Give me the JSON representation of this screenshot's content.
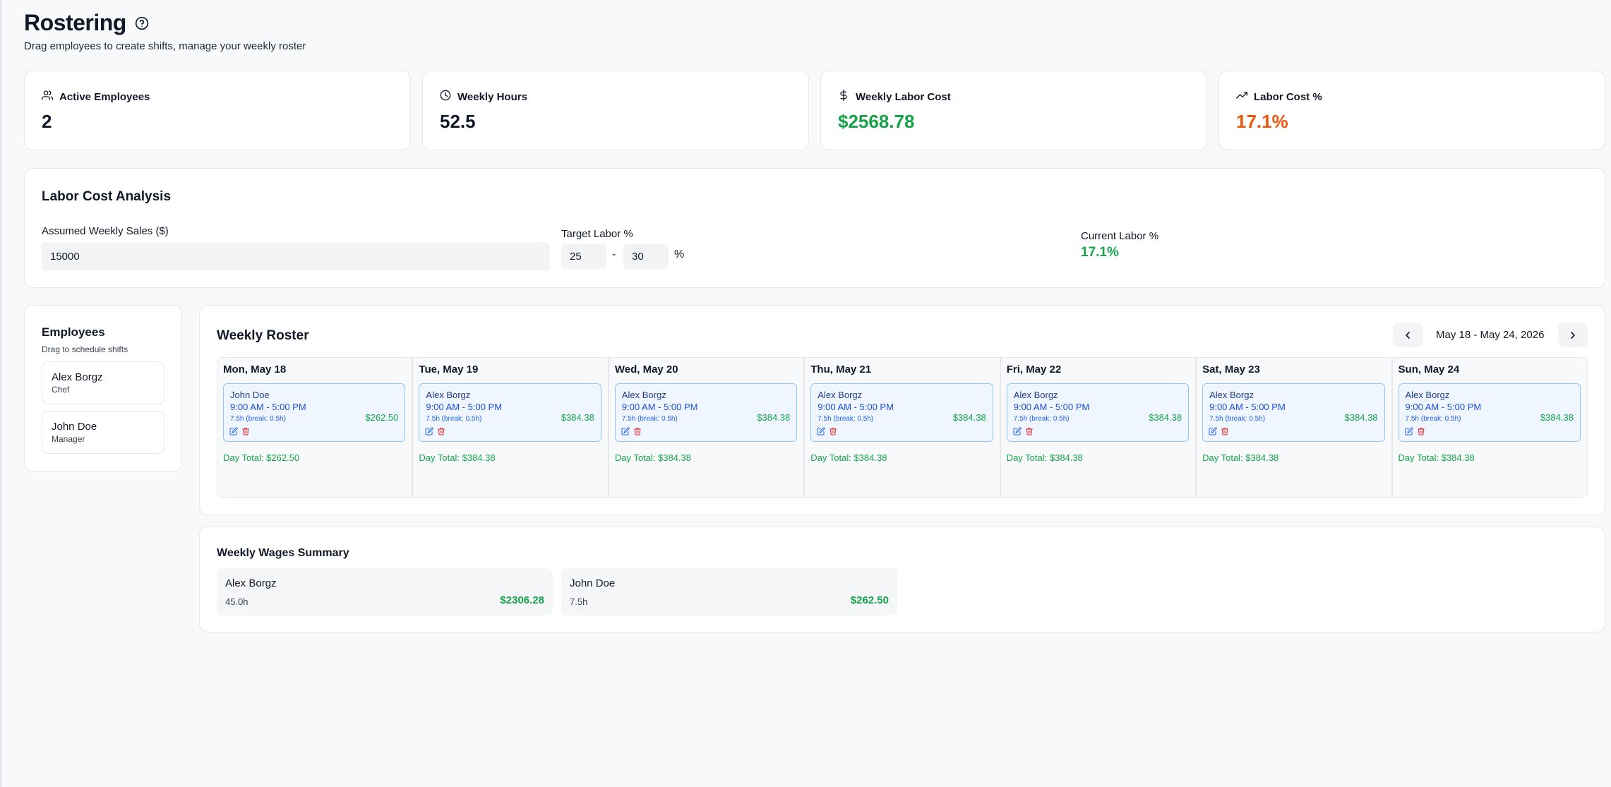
{
  "header": {
    "title": "Rostering",
    "subtitle": "Drag employees to create shifts, manage your weekly roster",
    "help_icon": "help-circle-icon"
  },
  "stats": [
    {
      "label": "Active Employees",
      "value": "2",
      "icon": "users-icon"
    },
    {
      "label": "Weekly Hours",
      "value": "52.5",
      "icon": "clock-icon"
    },
    {
      "label": "Weekly Labor Cost",
      "value": "$2568.78",
      "icon": "dollar-icon",
      "color": "#16a34a"
    },
    {
      "label": "Labor Cost %",
      "value": "17.1%",
      "icon": "trending-up-icon",
      "color": "#ea580c"
    }
  ],
  "labor_analysis": {
    "title": "Labor Cost Analysis",
    "sales_label": "Assumed Weekly Sales ($)",
    "sales_value": "15000",
    "target_label": "Target Labor %",
    "target_min": "25",
    "target_max": "30",
    "dash": "-",
    "percent_sign": "%",
    "current_label": "Current Labor %",
    "current_value": "17.1%"
  },
  "employees": {
    "title": "Employees",
    "subtitle": "Drag to schedule shifts",
    "items": [
      {
        "name": "Alex Borgz",
        "role": "Chef"
      },
      {
        "name": "John Doe",
        "role": "Manager"
      }
    ]
  },
  "roster": {
    "title": "Weekly Roster",
    "week_range": "May 18 - May 24, 2026",
    "prev_icon": "chevron-left-icon",
    "next_icon": "chevron-right-icon",
    "days": [
      {
        "label": "Mon, May 18",
        "shift": {
          "employee": "John Doe",
          "time": "9:00 AM - 5:00 PM",
          "meta": "7.5h (break: 0.5h)",
          "cost": "$262.50"
        },
        "total": "Day Total: $262.50"
      },
      {
        "label": "Tue, May 19",
        "shift": {
          "employee": "Alex Borgz",
          "time": "9:00 AM - 5:00 PM",
          "meta": "7.5h (break: 0.5h)",
          "cost": "$384.38"
        },
        "total": "Day Total: $384.38"
      },
      {
        "label": "Wed, May 20",
        "shift": {
          "employee": "Alex Borgz",
          "time": "9:00 AM - 5:00 PM",
          "meta": "7.5h (break: 0.5h)",
          "cost": "$384.38"
        },
        "total": "Day Total: $384.38"
      },
      {
        "label": "Thu, May 21",
        "shift": {
          "employee": "Alex Borgz",
          "time": "9:00 AM - 5:00 PM",
          "meta": "7.5h (break: 0.5h)",
          "cost": "$384.38"
        },
        "total": "Day Total: $384.38"
      },
      {
        "label": "Fri, May 22",
        "shift": {
          "employee": "Alex Borgz",
          "time": "9:00 AM - 5:00 PM",
          "meta": "7.5h (break: 0.5h)",
          "cost": "$384.38"
        },
        "total": "Day Total: $384.38"
      },
      {
        "label": "Sat, May 23",
        "shift": {
          "employee": "Alex Borgz",
          "time": "9:00 AM - 5:00 PM",
          "meta": "7.5h (break: 0.5h)",
          "cost": "$384.38"
        },
        "total": "Day Total: $384.38"
      },
      {
        "label": "Sun, May 24",
        "shift": {
          "employee": "Alex Borgz",
          "time": "9:00 AM - 5:00 PM",
          "meta": "7.5h (break: 0.5h)",
          "cost": "$384.38"
        },
        "total": "Day Total: $384.38"
      }
    ]
  },
  "wages": {
    "title": "Weekly Wages Summary",
    "items": [
      {
        "name": "Alex Borgz",
        "hours": "45.0h",
        "amount": "$2306.28"
      },
      {
        "name": "John Doe",
        "hours": "7.5h",
        "amount": "$262.50"
      }
    ]
  },
  "colors": {
    "accent_green": "#16a34a",
    "accent_orange": "#ea580c",
    "shift_bg": "#eff6ff",
    "shift_border": "#93c5fd",
    "delete_red": "#dc2626"
  }
}
